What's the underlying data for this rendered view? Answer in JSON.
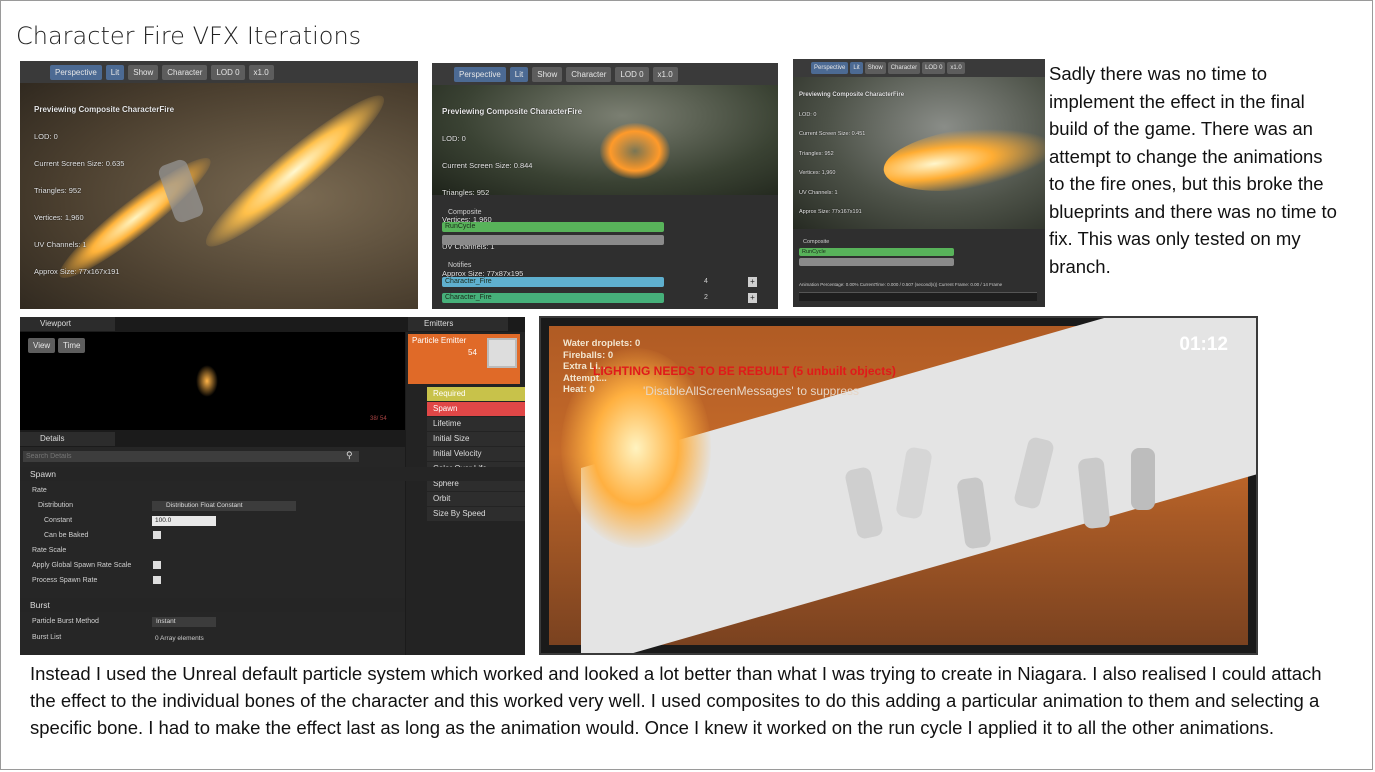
{
  "title": "Character Fire VFX Iterations",
  "side_paragraph": "Sadly there was no time  to implement the effect in the final build of the game. There was an attempt to change the animations to the fire ones, but this broke the blueprints and there was no time to fix. This was only tested on my branch.",
  "bottom_paragraph": "Instead I used the Unreal default particle system which worked and looked a lot better than what I was trying to create in Niagara. I also realised I could attach the effect to the individual bones of the character and this worked very well. I used composites to do this adding a particular animation to them and selecting a specific bone. I had to make the effect last as long as the animation would. Once I knew it worked on the run cycle I applied it to all the other animations.",
  "shot1": {
    "toolbar": [
      "Perspective",
      "Lit",
      "Show",
      "Character",
      "LOD 0",
      "x1.0"
    ],
    "stats_header": "Previewing Composite CharacterFire",
    "stats": [
      "LOD: 0",
      "Current Screen Size: 0.635",
      "Triangles: 952",
      "Vertices: 1,960",
      "UV Channels: 1",
      "Approx Size: 77x167x191"
    ]
  },
  "shot2": {
    "toolbar": [
      "Perspective",
      "Lit",
      "Show",
      "Character",
      "LOD 0",
      "x1.0"
    ],
    "stats_header": "Previewing Composite CharacterFire",
    "stats": [
      "LOD: 0",
      "Current Screen Size: 0.844",
      "Triangles: 952",
      "Vertices: 1,960",
      "UV Channels: 1",
      "Approx Size: 77x87x195"
    ],
    "composite_label": "Composite",
    "runcycle": "RunCycle",
    "notifies_label": "Notifies",
    "notify1": "Character_Fire",
    "notify2": "Character_Fire",
    "notify1_track": "4",
    "notify2_track": "2"
  },
  "shot3": {
    "toolbar": [
      "Perspective",
      "Lit",
      "Show",
      "Character",
      "LOD 0",
      "x1.0"
    ],
    "stats_header": "Previewing Composite CharacterFire",
    "stats": [
      "LOD: 0",
      "Current Screen Size: 0.451",
      "Triangles: 952",
      "Vertices: 1,960",
      "UV Channels: 1",
      "Approx Size: 77x167x191"
    ],
    "composite_label": "Composite",
    "runcycle": "RunCycle",
    "status": "Animation Percentage: 0.00% CurrentTime: 0.000 / 0.507 (second(s)) Current Frame: 0.00 / 14 Frame"
  },
  "shot4": {
    "viewport_tab": "Viewport",
    "view_btn": "View",
    "time_btn": "Time",
    "emitters_tab": "Emitters",
    "emitter_name": "Particle Emitter",
    "emitter_count": "54",
    "viewport_counter": "38/ 54",
    "modules": [
      "Required",
      "Spawn",
      "Lifetime",
      "Initial Size",
      "Initial Velocity",
      "Color Over Life",
      "Sphere",
      "Orbit",
      "Size By Speed"
    ],
    "details_tab": "Details",
    "search_placeholder": "Search Details",
    "spawn_section": "Spawn",
    "rate": "Rate",
    "distribution": "Distribution",
    "distribution_value": "Distribution Float Constant",
    "constant": "Constant",
    "constant_value": "100.0",
    "can_be_baked": "Can be Baked",
    "rate_scale": "Rate Scale",
    "apply_global": "Apply Global Spawn Rate Scale",
    "process_spawn": "Process Spawn Rate",
    "burst_section": "Burst",
    "burst_method": "Particle Burst Method",
    "burst_method_value": "Instant",
    "burst_list": "Burst List",
    "burst_list_value": "0 Array elements"
  },
  "shot5": {
    "timer": "01:12",
    "hud": [
      "Water droplets: 0",
      "Fireballs: 0",
      "Extra Li...",
      "Attempt...",
      "Heat: 0"
    ],
    "warning": "LIGHTING NEEDS TO BE REBUILT (5 unbuilt objects)",
    "suppress": "'DisableAllScreenMessages' to suppress"
  }
}
